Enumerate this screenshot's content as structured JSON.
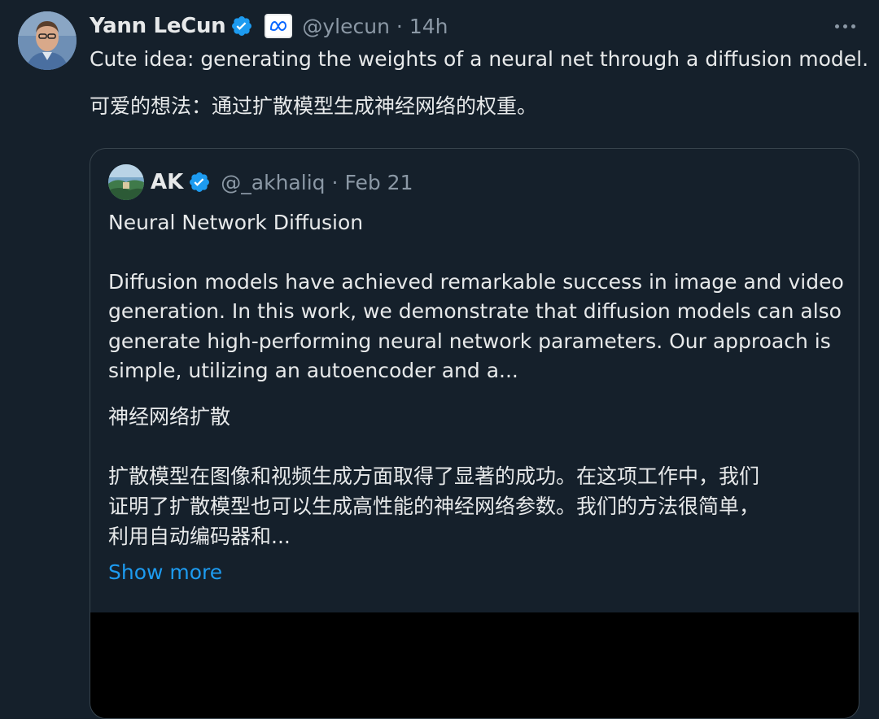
{
  "tweet": {
    "author_name": "Yann LeCun",
    "handle": "@ylecun",
    "separator": "·",
    "time": "14h",
    "text_lines": [
      "Cute idea: generating the weights of a neural net through a diffusion model.",
      "可爱的想法：通过扩散模型生成神经网络的权重。"
    ]
  },
  "quote": {
    "author_name": "AK",
    "handle": "@_akhaliq",
    "separator": "·",
    "date": "Feb 21",
    "title": "Neural Network Diffusion",
    "body_lines": [
      "Diffusion models have achieved remarkable success in image and video",
      "generation. In this work, we demonstrate that diffusion models can also",
      "generate high-performing neural network parameters. Our approach is",
      "simple, utilizing an autoencoder and a..."
    ],
    "title_cn": "神经网络扩散",
    "body_cn_lines": [
      "扩散模型在图像和视频生成方面取得了显著的成功。在这项工作中，我们",
      "证明了扩散模型也可以生成高性能的神经网络参数。我们的方法很简单，",
      "利用自动编码器和..."
    ],
    "show_more": "Show more"
  },
  "colors": {
    "background": "#15202b",
    "link": "#1d9bf0",
    "verified": "#1d9bf0",
    "muted": "#8b98a5"
  }
}
